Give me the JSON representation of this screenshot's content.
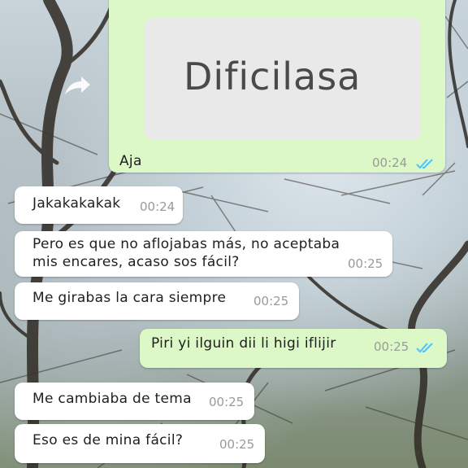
{
  "image_message": {
    "image_text": "Dificilasa",
    "caption": "Aja",
    "time": "00:24"
  },
  "messages": [
    {
      "side": "in",
      "text": "Jakakakakak",
      "time": "00:24"
    },
    {
      "side": "in",
      "text": "Pero es que no aflojabas más, no aceptaba",
      "text2": "mis encares, acaso sos fácil?",
      "time": "00:25"
    },
    {
      "side": "in",
      "text": "Me girabas la cara siempre",
      "time": "00:25"
    },
    {
      "side": "out",
      "text": "Piri yi ilguin dii li higi iflijir",
      "time": "00:25"
    },
    {
      "side": "in",
      "text": "Me cambiaba de tema",
      "time": "00:25"
    },
    {
      "side": "in",
      "text": "Eso es de mina fácil?",
      "time": "00:25"
    }
  ],
  "colors": {
    "incoming": "#ffffff",
    "outgoing": "#dcf8c6",
    "read_ticks": "#4fc3f7"
  },
  "icons": {
    "forward": "share-icon",
    "read_receipt": "double-check-icon"
  }
}
